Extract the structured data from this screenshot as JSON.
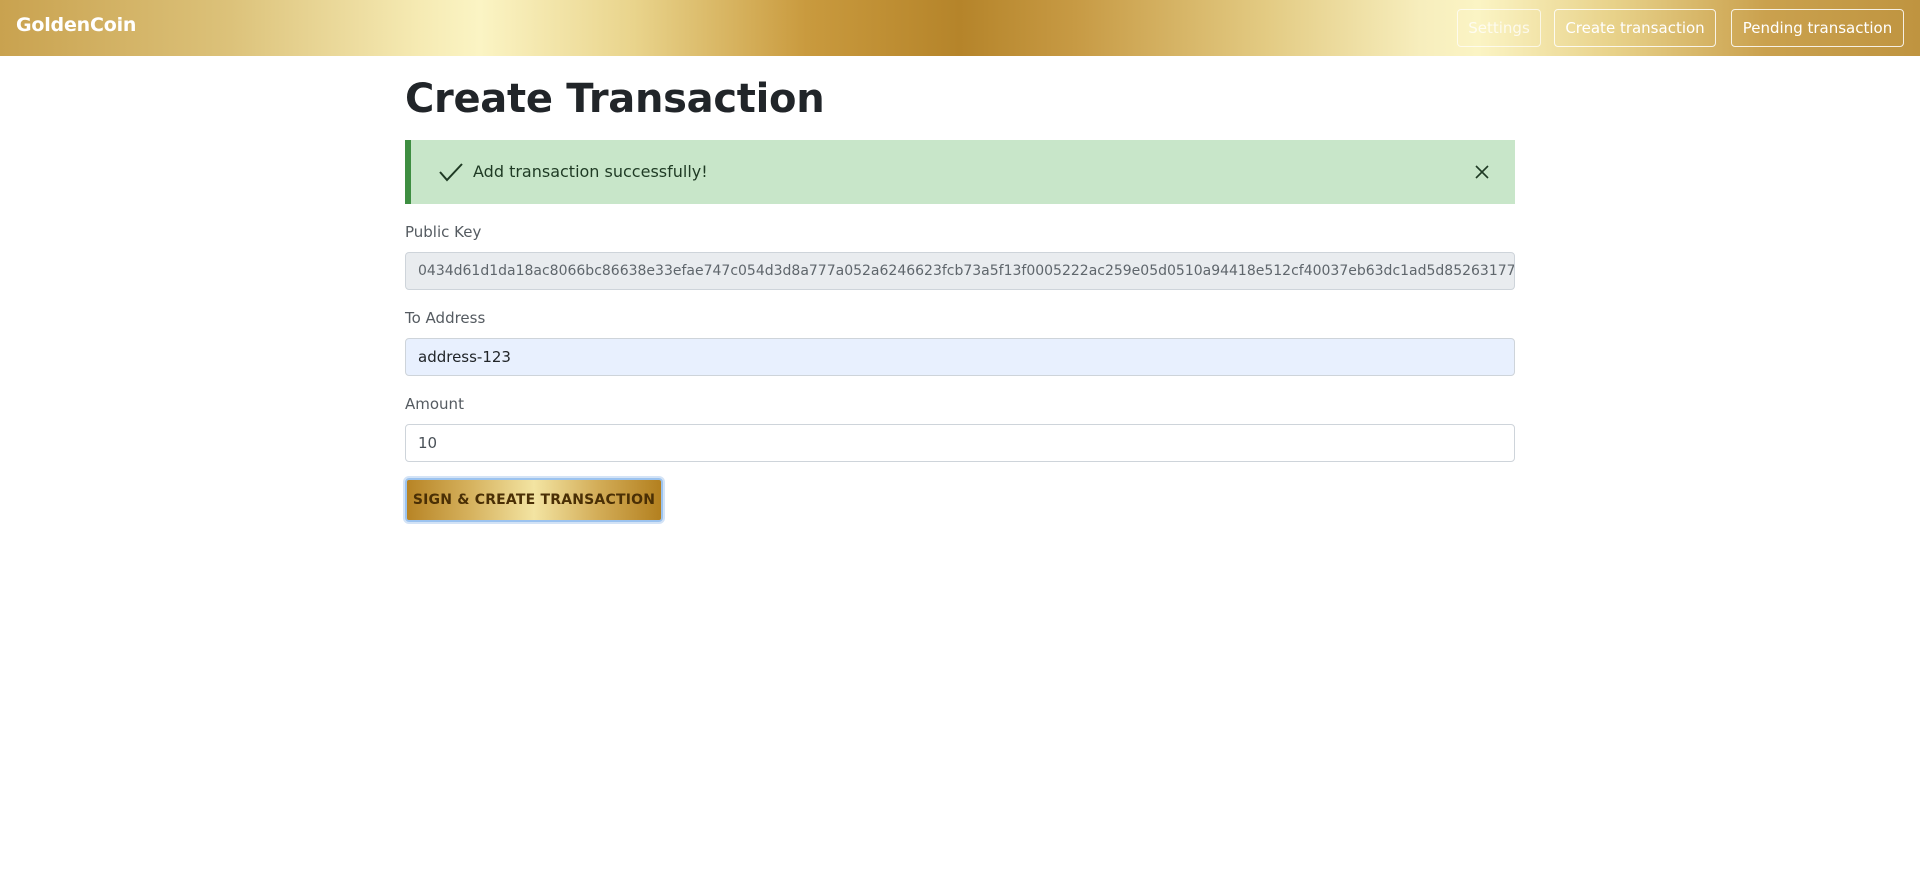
{
  "navbar": {
    "brand": "GoldenCoin",
    "buttons": {
      "settings": "Settings",
      "create": "Create transaction",
      "pending": "Pending transaction"
    }
  },
  "page": {
    "title": "Create Transaction"
  },
  "alert": {
    "message": "Add transaction successfully!",
    "icon": "check-icon",
    "close_icon": "close-icon",
    "background_color": "#c8e6c9",
    "accent_color": "#3e8e41"
  },
  "form": {
    "public_key": {
      "label": "Public Key",
      "value": "0434d61d1da18ac8066bc86638e33efae747c054d3d8a777a052a6246623fcb73a5f13f0005222ac259e05d0510a94418e512cf40037eb63dc1ad5d85263177"
    },
    "to_address": {
      "label": "To Address",
      "value": "address-123"
    },
    "amount": {
      "label": "Amount",
      "value": "10"
    },
    "submit_label": "SIGN & CREATE TRANSACTION"
  }
}
